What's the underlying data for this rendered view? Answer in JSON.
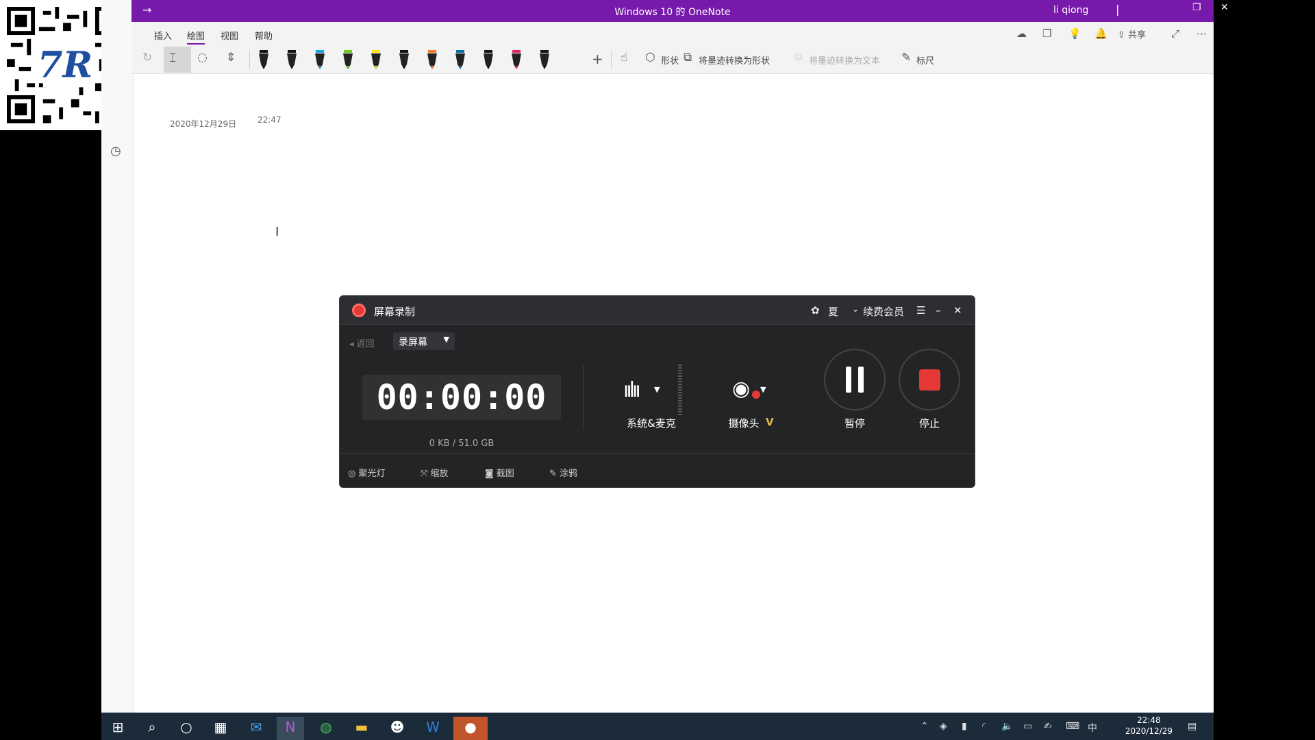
{
  "colors": {
    "onenote_purple": "#7719aa",
    "recorder_bg": "#222426",
    "stop_red": "#e53935",
    "taskbar": "#1c2b3a"
  },
  "titlebar": {
    "title": "Windows 10 的 OneNote",
    "user": "li qiong",
    "separator": "|",
    "back_icon": "arrow-right-icon"
  },
  "menu": {
    "tabs": [
      "插入",
      "绘图",
      "视图",
      "帮助"
    ],
    "active": "绘图",
    "share": "共享"
  },
  "ribbon": {
    "shapes": "形状",
    "ink_to_shape": "将墨迹转换为形状",
    "ink_to_text": "将墨迹转换为文本",
    "ruler": "标尺",
    "pen_colors": [
      "#111111",
      "#111111",
      "#19a0d6",
      "#6cc91b",
      "#f5e20e",
      "#111111",
      "#f0782a",
      "#0a6ea6",
      "#111111",
      "#e1246a",
      "#111111"
    ]
  },
  "page": {
    "date": "2020年12月29日",
    "time": "22:47"
  },
  "recorder": {
    "title": "屏幕录制",
    "member": "续费会员",
    "user_short": "夏",
    "back": "返回",
    "mode": "录屏幕",
    "timer": "00:00:00",
    "size": "0 KB / 51.0 GB",
    "audio_label": "系统&麦克",
    "camera_label": "摄像头",
    "vip_mark": "V",
    "pause_label": "暂停",
    "stop_label": "停止",
    "footer": [
      "聚光灯",
      "缩放",
      "截图",
      "涂鸦"
    ]
  },
  "taskbar": {
    "time": "22:48",
    "date": "2020/12/29",
    "ime": "中"
  }
}
